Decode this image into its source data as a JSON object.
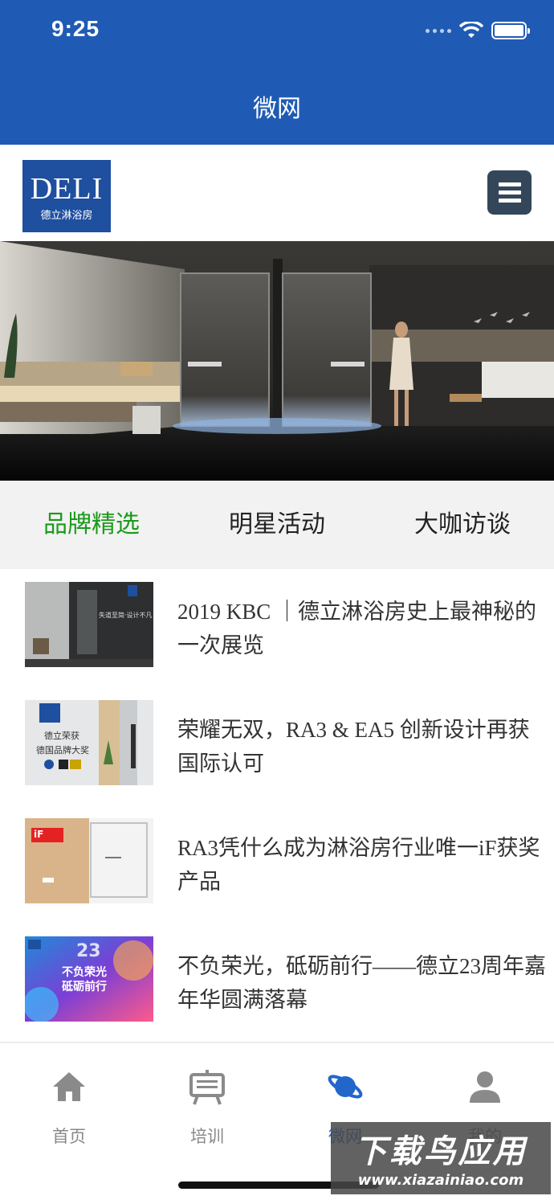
{
  "status": {
    "time": "9:25"
  },
  "nav": {
    "title": "微网"
  },
  "header": {
    "logo_word": "DELI",
    "logo_sub": "德立淋浴房"
  },
  "categories": [
    {
      "label": "品牌精选",
      "active": true
    },
    {
      "label": "明星活动",
      "active": false
    },
    {
      "label": "大咖访谈",
      "active": false
    }
  ],
  "articles": [
    {
      "title": "2019 KBC ｜德立淋浴房史上最神秘的一次展览"
    },
    {
      "title": "荣耀无双，RA3 & EA5 创新设计再获国际认可"
    },
    {
      "title": "RA3凭什么成为淋浴房行业唯一iF获奖产品"
    },
    {
      "title": "不负荣光，砥砺前行——德立23周年嘉年华圆满落幕"
    }
  ],
  "thumbs": {
    "t1_caption": "失道至简·设计不凡",
    "t2_line1": "德立荣获",
    "t2_line2": "德国品牌大奖",
    "t3_badge": "iF",
    "t4_big": "23",
    "t4_line1": "不负荣光",
    "t4_line2": "砥砺前行"
  },
  "tabbar": {
    "items": [
      {
        "label": "首页",
        "icon": "home-icon"
      },
      {
        "label": "培训",
        "icon": "easel-icon"
      },
      {
        "label": "微网",
        "icon": "planet-icon",
        "active": true
      },
      {
        "label": "我的",
        "icon": "person-icon"
      }
    ]
  },
  "watermark": {
    "title": "下载鸟应用",
    "url": "www.xiazainiao.com"
  },
  "colors": {
    "brand_blue": "#1f5bb5",
    "active_green": "#1a9a1a",
    "tab_active": "#2266cc"
  }
}
